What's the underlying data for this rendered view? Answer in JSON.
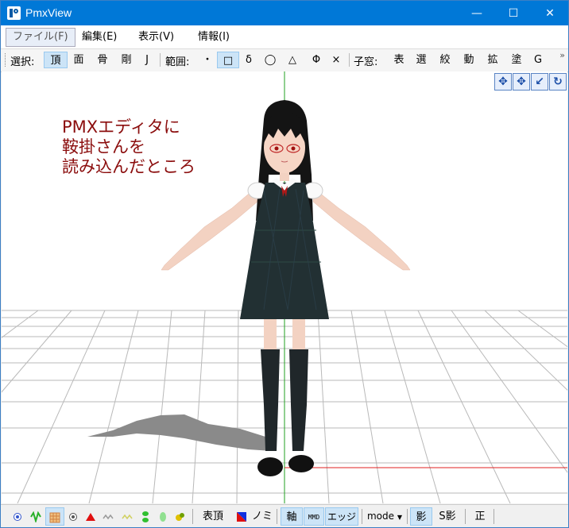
{
  "window": {
    "title": "PmxView",
    "minimize": "—",
    "maximize": "☐",
    "close": "✕"
  },
  "menu": {
    "file": "ファイル(F)",
    "edit": "編集(E)",
    "view": "表示(V)",
    "info": "情報(I)"
  },
  "toolbar": {
    "select_label": "選択:",
    "select_items": [
      "頂",
      "面",
      "骨",
      "剛",
      "J"
    ],
    "range_label": "範囲:",
    "range_items": [
      "・",
      "□",
      "δ",
      "◯",
      "△",
      "Φ",
      "×"
    ],
    "subwindow_label": "子窓:",
    "subwindow_items": [
      "表",
      "選",
      "絞",
      "動",
      "拡",
      "塗",
      "G"
    ],
    "overflow": "»"
  },
  "viewport": {
    "annotation": [
      "PMXエディタに",
      "鞍掛さんを",
      "読み込んだところ"
    ],
    "nav_icons": [
      "move-xy-icon",
      "move-xz-icon",
      "zoom-icon",
      "rotate-icon"
    ],
    "axis_colors": {
      "y": "#22a022",
      "x": "#e02020"
    }
  },
  "bottombar": {
    "show_vertex": "表頂",
    "nomi": "ノミ",
    "axis": "軸",
    "mmd": "MMD",
    "edge": "エッジ",
    "mode": "mode",
    "shadow": "影",
    "s_shadow": "S影",
    "front": "正"
  },
  "colors": {
    "titlebar": "#0078d7",
    "annotation": "#8b0d0d",
    "dress": "#223033",
    "hair": "#141414",
    "skin": "#f6d6c6"
  }
}
